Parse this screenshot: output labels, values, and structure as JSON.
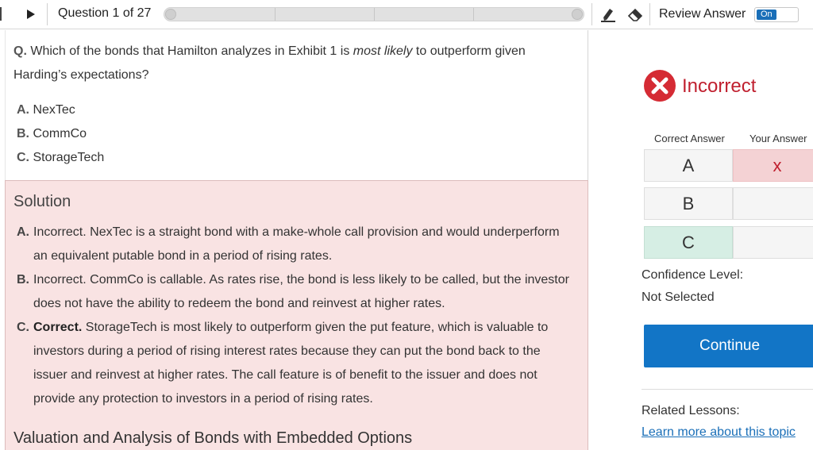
{
  "toolbar": {
    "question_counter": "Question 1 of 27",
    "progress": {
      "current": 1,
      "total": 27
    },
    "review_answer_label": "Review Answer",
    "review_toggle_state": "On",
    "icons": [
      "play-icon",
      "highlighter-icon",
      "eraser-icon"
    ]
  },
  "question": {
    "prefix": "Q.",
    "text_before": " Which of the bonds that Hamilton analyzes in Exhibit 1 is ",
    "text_emphasis": "most likely",
    "text_after": " to outperform given Harding’s expectations?",
    "choices": [
      {
        "letter": "A.",
        "label": "NexTec"
      },
      {
        "letter": "B.",
        "label": "CommCo"
      },
      {
        "letter": "C.",
        "label": "StorageTech"
      }
    ]
  },
  "solution": {
    "title": "Solution",
    "items": [
      {
        "letter": "A.",
        "lead": "",
        "text": "Incorrect. NexTec is a straight bond with a make-whole call provision and would underperform an equivalent putable bond in a period of rising rates."
      },
      {
        "letter": "B.",
        "lead": "",
        "text": "Incorrect. CommCo is callable. As rates rise, the bond is less likely to be called, but the investor does not have the ability to redeem the bond and reinvest at higher rates."
      },
      {
        "letter": "C.",
        "lead": "Correct.",
        "text": " StorageTech is most likely to outperform given the put feature, which is valuable to investors during a period of rising interest rates because they can put the bond back to the issuer and reinvest at higher rates. The call feature is of benefit to the issuer and does not provide any protection to investors in a period of rising rates."
      }
    ],
    "section_title": "Valuation and Analysis of Bonds with Embedded Options"
  },
  "result": {
    "status": "Incorrect",
    "status_color": "#c0202f",
    "correct_answer_header": "Correct Answer",
    "your_answer_header": "Your Answer",
    "rows": [
      {
        "correct": "A",
        "yours": "x"
      },
      {
        "correct": "B",
        "yours": ""
      },
      {
        "correct": "C",
        "yours": ""
      }
    ],
    "confidence_label": "Confidence Level:",
    "confidence_value": "Not Selected",
    "continue_label": "Continue",
    "related_label": "Related Lessons:",
    "related_link": "Learn more about this topic"
  }
}
